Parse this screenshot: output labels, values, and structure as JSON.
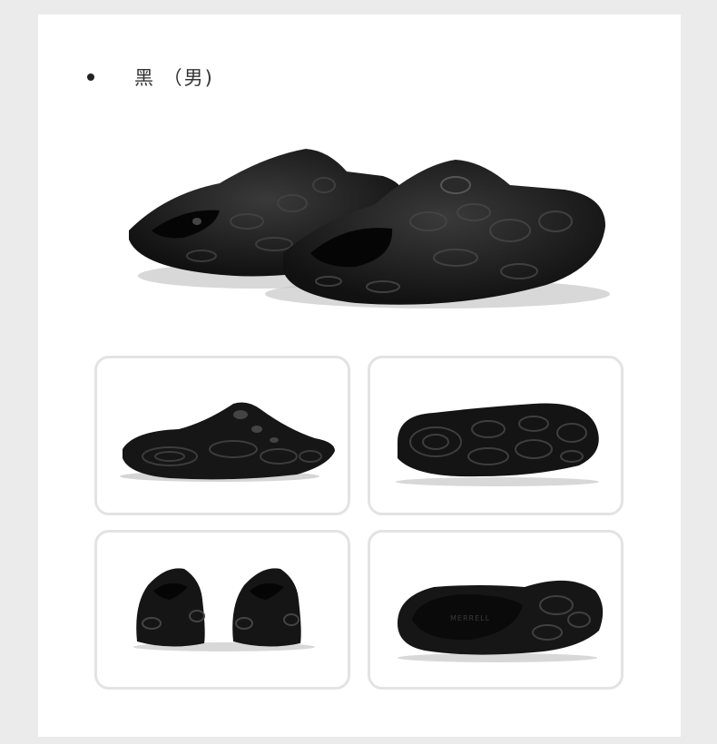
{
  "product": {
    "variant_label": "黑 （男)",
    "color": "#151515",
    "accent": "#2a2a2a"
  },
  "images": {
    "hero": "slide-pair-icon",
    "side": "slide-side-icon",
    "sole": "slide-sole-icon",
    "back": "slide-back-icon",
    "top": "slide-top-icon"
  },
  "brand_mark": "MERRELL"
}
